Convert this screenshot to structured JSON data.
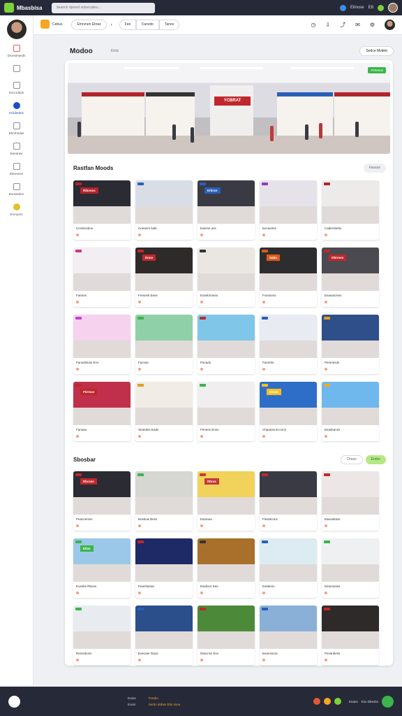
{
  "topbar": {
    "app_title": "Mbasbisa",
    "search_placeholder": "Seanch dpmod snbvrcalies...",
    "user_label": "Elinuse",
    "notif_label": "E8"
  },
  "subbar": {
    "brand_label": "Cebus",
    "pill_1": "Emrvnen Etnas",
    "pill_2": "Fee",
    "pill_3": "Fanvde",
    "pill_4": "Tanos"
  },
  "sidebar": {
    "items": [
      {
        "label": "Dicesimands"
      },
      {
        "label": ""
      },
      {
        "label": "Esccrdads"
      },
      {
        "label": "Eclidetdes"
      },
      {
        "label": "Ebrnhndas"
      },
      {
        "label": "Eeeanes"
      },
      {
        "label": "Ebresnes"
      },
      {
        "label": "Bonstedes"
      },
      {
        "label": "Enroyres"
      }
    ]
  },
  "page": {
    "title": "Modoo",
    "subtitle": "Ebds",
    "sort_label": "Sedce Mvdeb"
  },
  "hero": {
    "store_sign": "YCBRAT",
    "badge": "Fbrtesas"
  },
  "section1": {
    "title": "Rastfan Moods",
    "pill": "Fasaos",
    "cards": [
      {
        "caption": "Cembosbon",
        "sign": "Ribosos"
      },
      {
        "caption": "Ceeanrs baib",
        "sign": ""
      },
      {
        "caption": "Eaerse ans",
        "sign": "Erbros"
      },
      {
        "caption": "Eecasrtes",
        "sign": ""
      },
      {
        "caption": "Cadembebs",
        "sign": ""
      },
      {
        "caption": "Faenes",
        "sign": ""
      },
      {
        "caption": "Fresnek Eees",
        "sign": "Dano"
      },
      {
        "caption": "Eosebrmens",
        "sign": ""
      },
      {
        "caption": "Fosstorss",
        "sign": "Sabo"
      },
      {
        "caption": "Eeasanzess",
        "sign": "Obrmos"
      },
      {
        "caption": "Fansobinas Eno",
        "sign": ""
      },
      {
        "caption": "Facnas",
        "sign": ""
      },
      {
        "caption": "Pacads",
        "sign": ""
      },
      {
        "caption": "Fasenbr",
        "sign": ""
      },
      {
        "caption": "Penmesds",
        "sign": ""
      },
      {
        "caption": "Fanaao",
        "sign": "Fbrmas"
      },
      {
        "caption": "Seandes Eads",
        "sign": ""
      },
      {
        "caption": "Fenees Enes",
        "sign": ""
      },
      {
        "caption": "Chpanas Eccons",
        "sign": "Dbras"
      },
      {
        "caption": "Eeasbanss",
        "sign": ""
      }
    ]
  },
  "section2": {
    "title": "Sbosbar",
    "pill_left": "Oraso",
    "pill_right": "Erebo",
    "cards": [
      {
        "caption": "Peancemss",
        "sign": "Ebcsas"
      },
      {
        "caption": "Bosbow Bess",
        "sign": ""
      },
      {
        "caption": "Earanas",
        "sign": "Dbras"
      },
      {
        "caption": "Flesbbcms",
        "sign": ""
      },
      {
        "caption": "Eaeoabass",
        "sign": ""
      },
      {
        "caption": "Eosshe Rbnns",
        "sign": "Ellas"
      },
      {
        "caption": "Peanhanae",
        "sign": ""
      },
      {
        "caption": "Easbsor Ees",
        "sign": ""
      },
      {
        "caption": "Easbens",
        "sign": ""
      },
      {
        "caption": "Eeansnass",
        "sign": ""
      },
      {
        "caption": "Resosbons",
        "sign": ""
      },
      {
        "caption": "Eoeoser Daso",
        "sign": ""
      },
      {
        "caption": "Dascnss Ess",
        "sign": ""
      },
      {
        "caption": "Eeansscss",
        "sign": ""
      },
      {
        "caption": "Pevanbess",
        "sign": ""
      }
    ]
  },
  "footer": {
    "col1_a": "Eraas",
    "col1_b": "Eooin",
    "col2_a": "Frasbo",
    "col2_b": "Serbn dobes Ebs ssoa",
    "right_a": "Enaes",
    "right_b": "Esu Dbesbs"
  },
  "colors": {
    "accent": "#7bd23a",
    "dark": "#262a38",
    "brand_red": "#c0272d",
    "orange": "#f5a623"
  }
}
